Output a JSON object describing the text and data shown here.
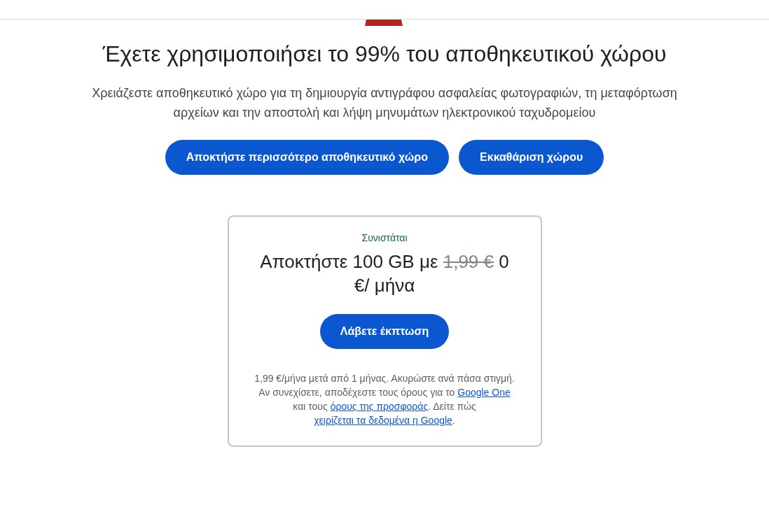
{
  "title": "Έχετε χρησιμοποιήσει το 99% του αποθηκευτικού χώρου",
  "subtitle": "Χρειάζεστε αποθηκευτικό χώρο για τη δημιουργία αντιγράφου ασφαλείας φωτογραφιών, τη μεταφόρτωση αρχείων και την αποστολή και λήψη μηνυμάτων ηλεκτρονικού ταχυδρομείου",
  "buttons": [
    "Αποκτήστε περισσότερο αποθηκευτικό χώρο",
    "Εκκαθάριση χώρου"
  ],
  "offer": {
    "badge": "Συνιστάται",
    "headline": [
      {
        "kind": "text",
        "text": "Αποκτήστε 100 GB με "
      },
      {
        "kind": "old_price",
        "text": "1,99 €"
      },
      {
        "kind": "text",
        "text": " 0 €/ μήνα"
      }
    ],
    "button": "Λάβετε έκπτωση",
    "fine_print": [
      {
        "kind": "text",
        "text": "1,99 €/μήνα μετά από 1 μήνας. Ακυρώστε ανά πάσα στιγμή. Αν συνεχίσετε, αποδέχεστε τους όρους για το "
      },
      {
        "kind": "link",
        "text": "Google One"
      },
      {
        "kind": "text",
        "text": " και τους "
      },
      {
        "kind": "link",
        "text": "όρους της προσφοράς"
      },
      {
        "kind": "text",
        "text": ". Δείτε πώς "
      },
      {
        "kind": "link",
        "text": "χειρίζεται τα δεδομένα η Google"
      },
      {
        "kind": "text",
        "text": "."
      }
    ]
  }
}
